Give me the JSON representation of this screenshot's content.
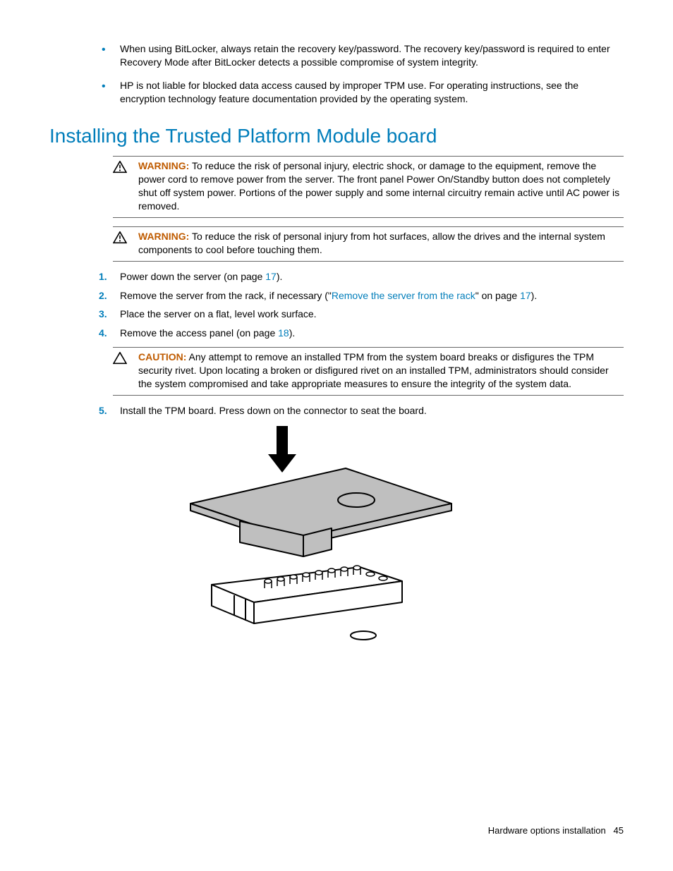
{
  "intro_bullets": [
    "When using BitLocker, always retain the recovery key/password. The recovery key/password is required to enter Recovery Mode after BitLocker detects a possible compromise of system integrity.",
    "HP is not liable for blocked data access caused by improper TPM use. For operating instructions, see the encryption technology feature documentation provided by the operating system."
  ],
  "heading": "Installing the Trusted Platform Module board",
  "warnings": [
    {
      "label": "WARNING:",
      "text": "  To reduce the risk of personal injury, electric shock, or damage to the equipment, remove the power cord to remove power from the server. The front panel Power On/Standby button does not completely shut off system power. Portions of the power supply and some internal circuitry remain active until AC power is removed."
    },
    {
      "label": "WARNING:",
      "text": "  To reduce the risk of personal injury from hot surfaces, allow the drives and the internal system components to cool before touching them."
    }
  ],
  "steps": {
    "s1": {
      "num": "1.",
      "pre": "Power down the server (on page ",
      "link": "17",
      "post": ")."
    },
    "s2": {
      "num": "2.",
      "pre": "Remove the server from the rack, if necessary (\"",
      "link1": "Remove the server from the rack",
      "mid": "\" on page ",
      "link2": "17",
      "post": ")."
    },
    "s3": {
      "num": "3.",
      "text": "Place the server on a flat, level work surface."
    },
    "s4": {
      "num": "4.",
      "pre": "Remove the access panel (on page ",
      "link": "18",
      "post": ")."
    },
    "s5": {
      "num": "5.",
      "text": "Install the TPM board. Press down on the connector to seat the board."
    }
  },
  "caution": {
    "label": "CAUTION:",
    "text": "  Any attempt to remove an installed TPM from the system board breaks or disfigures the TPM security rivet. Upon locating a broken or disfigured rivet on an installed TPM, administrators should consider the system compromised and take appropriate measures to ensure the integrity of the system data."
  },
  "footer": {
    "section": "Hardware options installation",
    "page": "45"
  }
}
